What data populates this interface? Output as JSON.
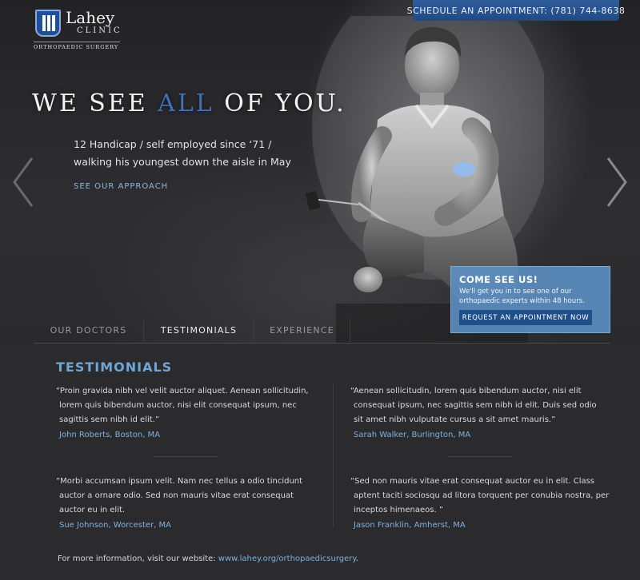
{
  "header": {
    "logo": {
      "name": "Lahey",
      "sub": "CLINIC",
      "tagline": "ORTHOPAEDIC SURGERY"
    },
    "schedule_label": "SCHEDULE AN APPOINTMENT:",
    "schedule_phone": "(781) 744-8638"
  },
  "hero": {
    "headline_pre": "WE SEE",
    "headline_accent": "ALL",
    "headline_post": "OF YOU.",
    "accent_color": "#3f6fb8",
    "sub_line_1": "12 Handicap / self employed since ‘71 /",
    "sub_line_2": "walking his youngest down the aisle in May",
    "cta_label": "SEE OUR APPROACH",
    "arrows": {
      "left": "chevron-left-icon",
      "right": "chevron-right-icon"
    }
  },
  "promo": {
    "title": "COME SEE US!",
    "text": "We'll get you in to see one of our orthopaedic experts within 48 hours.",
    "button_label": "REQUEST AN APPOINTMENT NOW"
  },
  "tabs": [
    {
      "label": "OUR DOCTORS",
      "active": false
    },
    {
      "label": "TESTIMONIALS",
      "active": true
    },
    {
      "label": "EXPERIENCE",
      "active": false
    }
  ],
  "testimonials": {
    "title": "TESTIMONIALS",
    "items": [
      {
        "lines": [
          "“Proin gravida nibh vel velit auctor aliquet. Aenean sollicitudin,",
          "lorem quis bibendum auctor, nisi elit consequat ipsum, nec",
          "sagittis sem nibh id elit.”"
        ],
        "author": "John Roberts, Boston, MA"
      },
      {
        "lines": [
          "“Aenean sollicitudin, lorem quis bibendum auctor, nisi elit",
          "consequat ipsum, nec sagittis sem nibh id elit. Duis sed odio",
          "sit amet nibh vulputate cursus a sit amet mauris.”"
        ],
        "author": "Sarah Walker, Burlington, MA"
      },
      {
        "lines": [
          "“Morbi accumsan ipsum velit. Nam nec tellus a odio tincidunt",
          "auctor a ornare odio. Sed non  mauris vitae erat consequat",
          "auctor eu in elit."
        ],
        "author": "Sue Johnson, Worcester, MA"
      },
      {
        "lines": [
          "“Sed non  mauris vitae erat consequat auctor eu in elit. Class",
          "aptent taciti sociosqu ad litora torquent per conubia nostra, per",
          "inceptos himenaeos. ”"
        ],
        "author": "Jason Franklin, Amherst, MA"
      }
    ]
  },
  "footer": {
    "prefix": "For more information, visit our website:",
    "link": "www.lahey.org/orthopaedicsurgery",
    "suffix": "."
  }
}
